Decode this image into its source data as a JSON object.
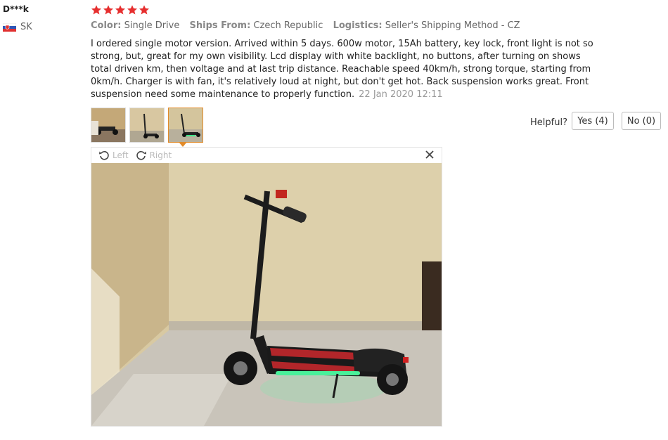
{
  "reviewer": {
    "name": "D***k",
    "country": "SK"
  },
  "rating": {
    "stars": 5,
    "color": "#e62e2e"
  },
  "meta": {
    "color_label": "Color:",
    "color_value": "Single Drive",
    "ships_label": "Ships From:",
    "ships_value": "Czech Republic",
    "logistics_label": "Logistics:",
    "logistics_value": "Seller's Shipping Method - CZ"
  },
  "review": {
    "text": "I ordered single motor version. Arrived within 5 days. 600w motor, 15Ah battery, key lock, front light is not so strong, but, great for my own visibility. Lcd display with white backlight, no buttons, after turning on shows total driven km, then voltage and at last trip distance. Reachable speed 40km/h, strong torque, starting from 0km/h. Charger is with fan, it's relatively loud at night, but don't get hot. Back suspension works great. Front suspension need some maintenance to properly function.",
    "date": "22 Jan 2020 12:11"
  },
  "helpful": {
    "label": "Helpful?",
    "yes_label": "Yes (4)",
    "no_label": "No (0)"
  },
  "viewer": {
    "left_label": "Left",
    "right_label": "Right",
    "accent": "#e28b2a"
  }
}
